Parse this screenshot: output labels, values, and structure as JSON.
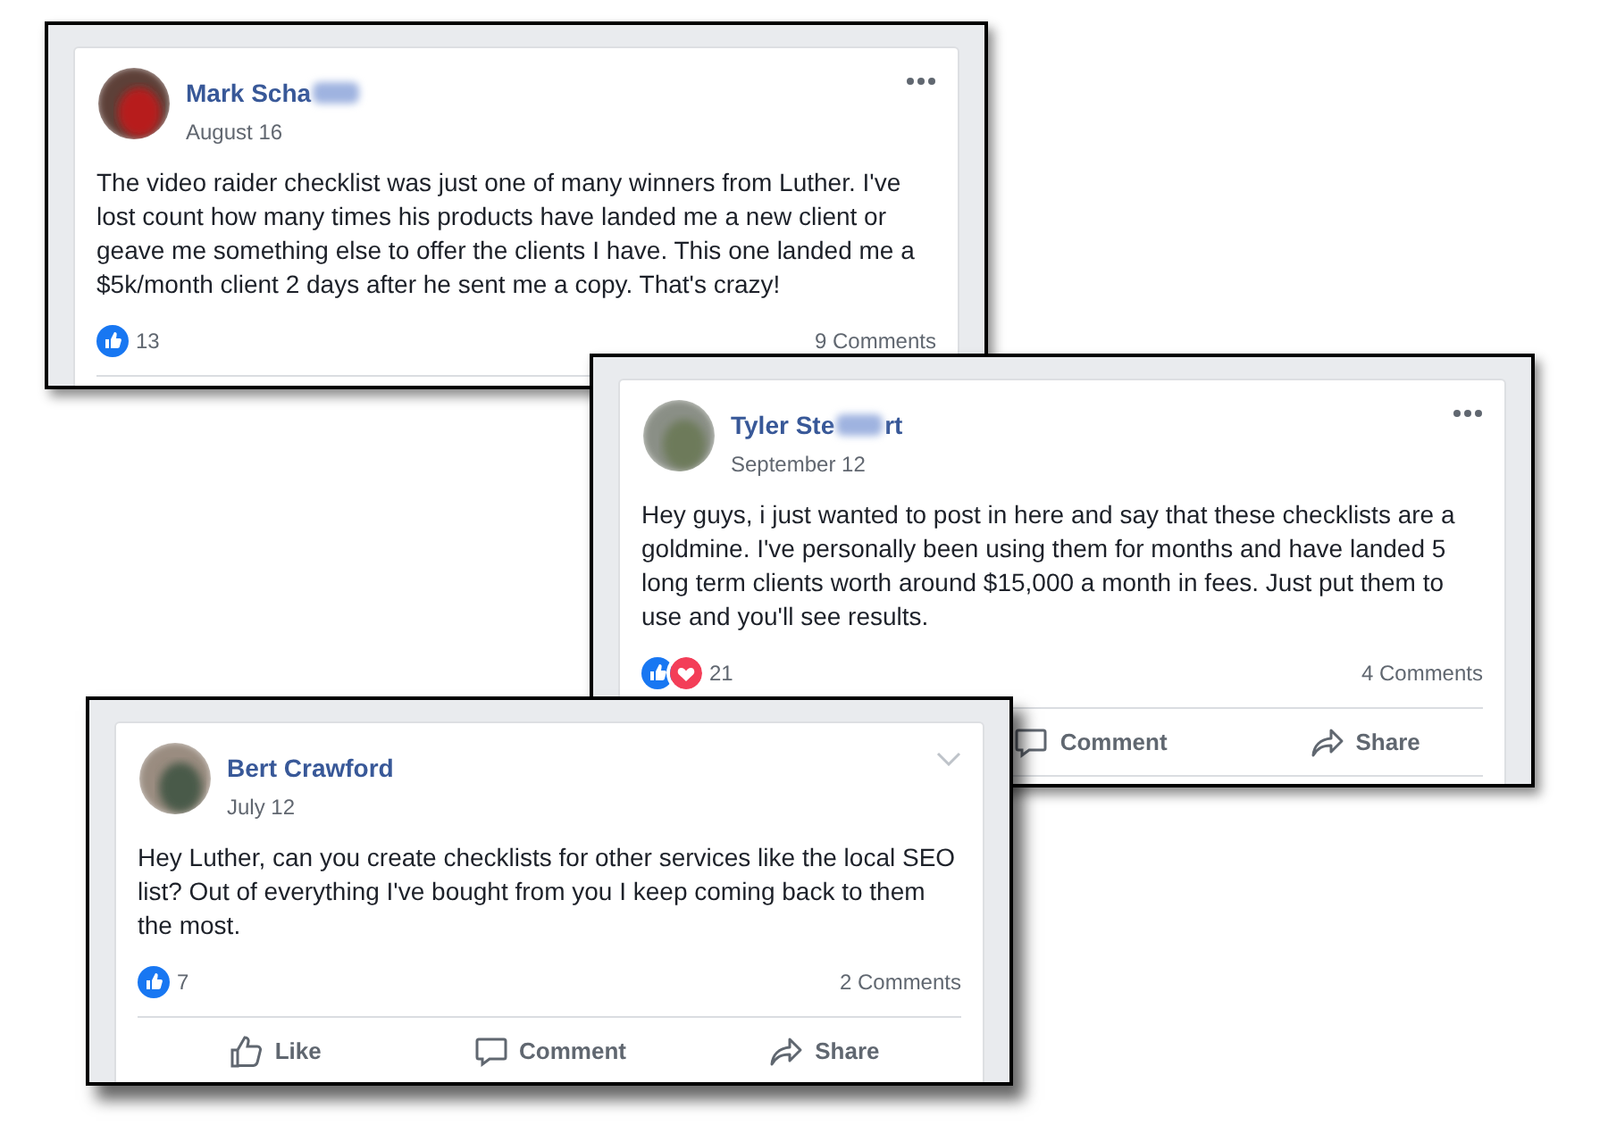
{
  "posts": [
    {
      "author_parts": [
        "Mark Scha"
      ],
      "redacted": true,
      "date": "August 16",
      "menu": {
        "kind": "dots"
      },
      "text": "The video raider checklist was just one of many winners from Luther. I've lost count how many times his products have landed me a new client or geave me something else to offer the clients I have. This one landed me a $5k/month client 2 days after he sent me a copy. That's crazy!",
      "reactions": [
        {
          "kind": "like"
        }
      ],
      "reaction_count": "13",
      "comments": "9 Comments"
    },
    {
      "author_parts": [
        "Tyler Ste",
        "rt"
      ],
      "redacted": true,
      "date": "September 12",
      "menu": {
        "kind": "dots"
      },
      "text": "Hey guys, i just wanted to post in here and say that these checklists are a goldmine. I've personally been using them for months and have landed 5 long term clients worth around $15,000 a month in fees. Just put them to use and you'll see results.",
      "reactions": [
        {
          "kind": "like"
        },
        {
          "kind": "love"
        }
      ],
      "reaction_count": "21",
      "comments": "4 Comments",
      "actions": [
        {
          "kind": "spacer"
        },
        {
          "kind": "comment",
          "label": "Comment"
        },
        {
          "kind": "share",
          "label": "Share"
        }
      ]
    },
    {
      "author_parts": [
        "Bert Crawford"
      ],
      "redacted": false,
      "date": "July 12",
      "menu": {
        "kind": "chevron"
      },
      "text": "Hey Luther, can you create checklists for other services like the local SEO list? Out of everything I've bought from you I keep coming back to them the most.",
      "reactions": [
        {
          "kind": "like"
        }
      ],
      "reaction_count": "7",
      "comments": "2 Comments",
      "actions": [
        {
          "kind": "like",
          "label": "Like"
        },
        {
          "kind": "comment",
          "label": "Comment"
        },
        {
          "kind": "share",
          "label": "Share"
        }
      ]
    }
  ]
}
